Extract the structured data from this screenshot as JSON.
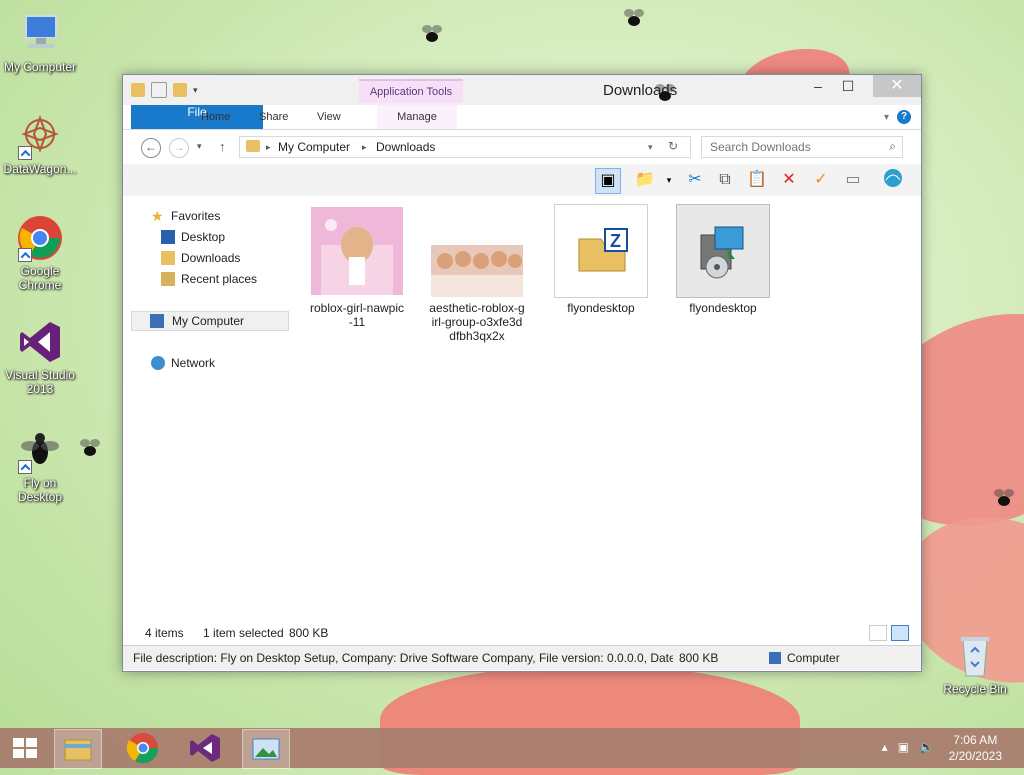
{
  "desktop": {
    "icons": [
      {
        "label": "My Computer"
      },
      {
        "label": "DataWagon..."
      },
      {
        "label": "Google Chrome"
      },
      {
        "label": "Visual Studio 2013"
      },
      {
        "label": "Fly on Desktop"
      },
      {
        "label": "Recycle Bin"
      }
    ]
  },
  "window": {
    "title": "Downloads",
    "contextual_tab": "Application Tools",
    "tabs": [
      "File",
      "Home",
      "Share",
      "View",
      "Manage"
    ],
    "address": {
      "segments": [
        "My Computer",
        "Downloads"
      ]
    },
    "search": {
      "placeholder": "Search Downloads"
    },
    "nav": {
      "favorites": "Favorites",
      "desktop": "Desktop",
      "downloads": "Downloads",
      "recent": "Recent places",
      "computer": "My Computer",
      "network": "Network"
    },
    "files": [
      {
        "name": "roblox-girl-nawpic-11"
      },
      {
        "name": "aesthetic-roblox-girl-group-o3xfe3ddfbh3qx2x"
      },
      {
        "name": "flyondesktop"
      },
      {
        "name": "flyondesktop"
      }
    ],
    "status": {
      "items": "4 items",
      "selected": "1 item selected",
      "size": "800 KB"
    },
    "description": {
      "text": "File description: Fly on Desktop Setup, Company: Drive Software Company, File version: 0.0.0.0, Date cre",
      "size": "800 KB",
      "location": "Computer"
    }
  },
  "taskbar": {
    "time": "7:06 AM",
    "date": "2/20/2023"
  },
  "colors": {
    "file_tab": "#1979ca",
    "contextual": "#f7dff7",
    "taskbar": "#a97f6f"
  }
}
